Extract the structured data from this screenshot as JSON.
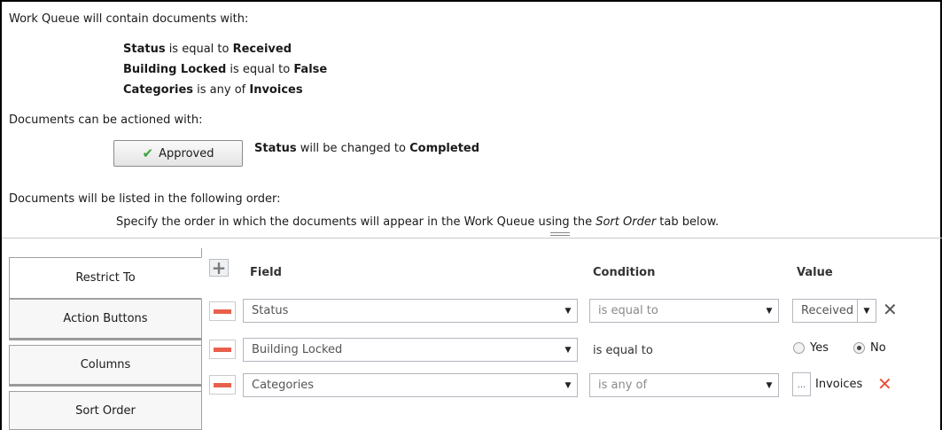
{
  "summary": {
    "contain_heading": "Work Queue will contain documents with:",
    "criteria": [
      {
        "field": "Status",
        "op": " is equal to ",
        "value": "Received"
      },
      {
        "field": "Building Locked",
        "op": " is equal to ",
        "value": "False"
      },
      {
        "field": "Categories",
        "op": " is any of ",
        "value": "Invoices"
      }
    ],
    "action_heading": "Documents can be actioned with:",
    "action_button_label": "Approved",
    "action_result": {
      "field": "Status",
      "op": " will be changed to ",
      "value": "Completed"
    },
    "order_heading": "Documents will be listed in the following order:",
    "order_note_pre": "Specify the order in which the documents will appear in the Work Queue using the ",
    "order_note_em": "Sort Order",
    "order_note_post": " tab below."
  },
  "tabs": [
    {
      "label": "Restrict To",
      "active": true
    },
    {
      "label": "Action Buttons",
      "active": false
    },
    {
      "label": "Columns",
      "active": false
    },
    {
      "label": "Sort Order",
      "active": false
    }
  ],
  "grid": {
    "headers": {
      "field": "Field",
      "condition": "Condition",
      "value": "Value"
    },
    "rows": [
      {
        "field": "Status",
        "condition": "is equal to",
        "value": "Received"
      },
      {
        "field": "Building Locked",
        "condition": "is equal to",
        "radio_yes": "Yes",
        "radio_no": "No",
        "selected": "No"
      },
      {
        "field": "Categories",
        "condition": "is any of",
        "value_button": "...",
        "value": "Invoices"
      }
    ]
  },
  "colors": {
    "remove_red": "#e8604c",
    "delete_x_red": "#e8503a",
    "check_green": "#3aa43a"
  },
  "icons": [
    "check-icon",
    "plus-icon",
    "minus-icon",
    "chevron-down-icon",
    "close-icon",
    "delete-icon"
  ]
}
